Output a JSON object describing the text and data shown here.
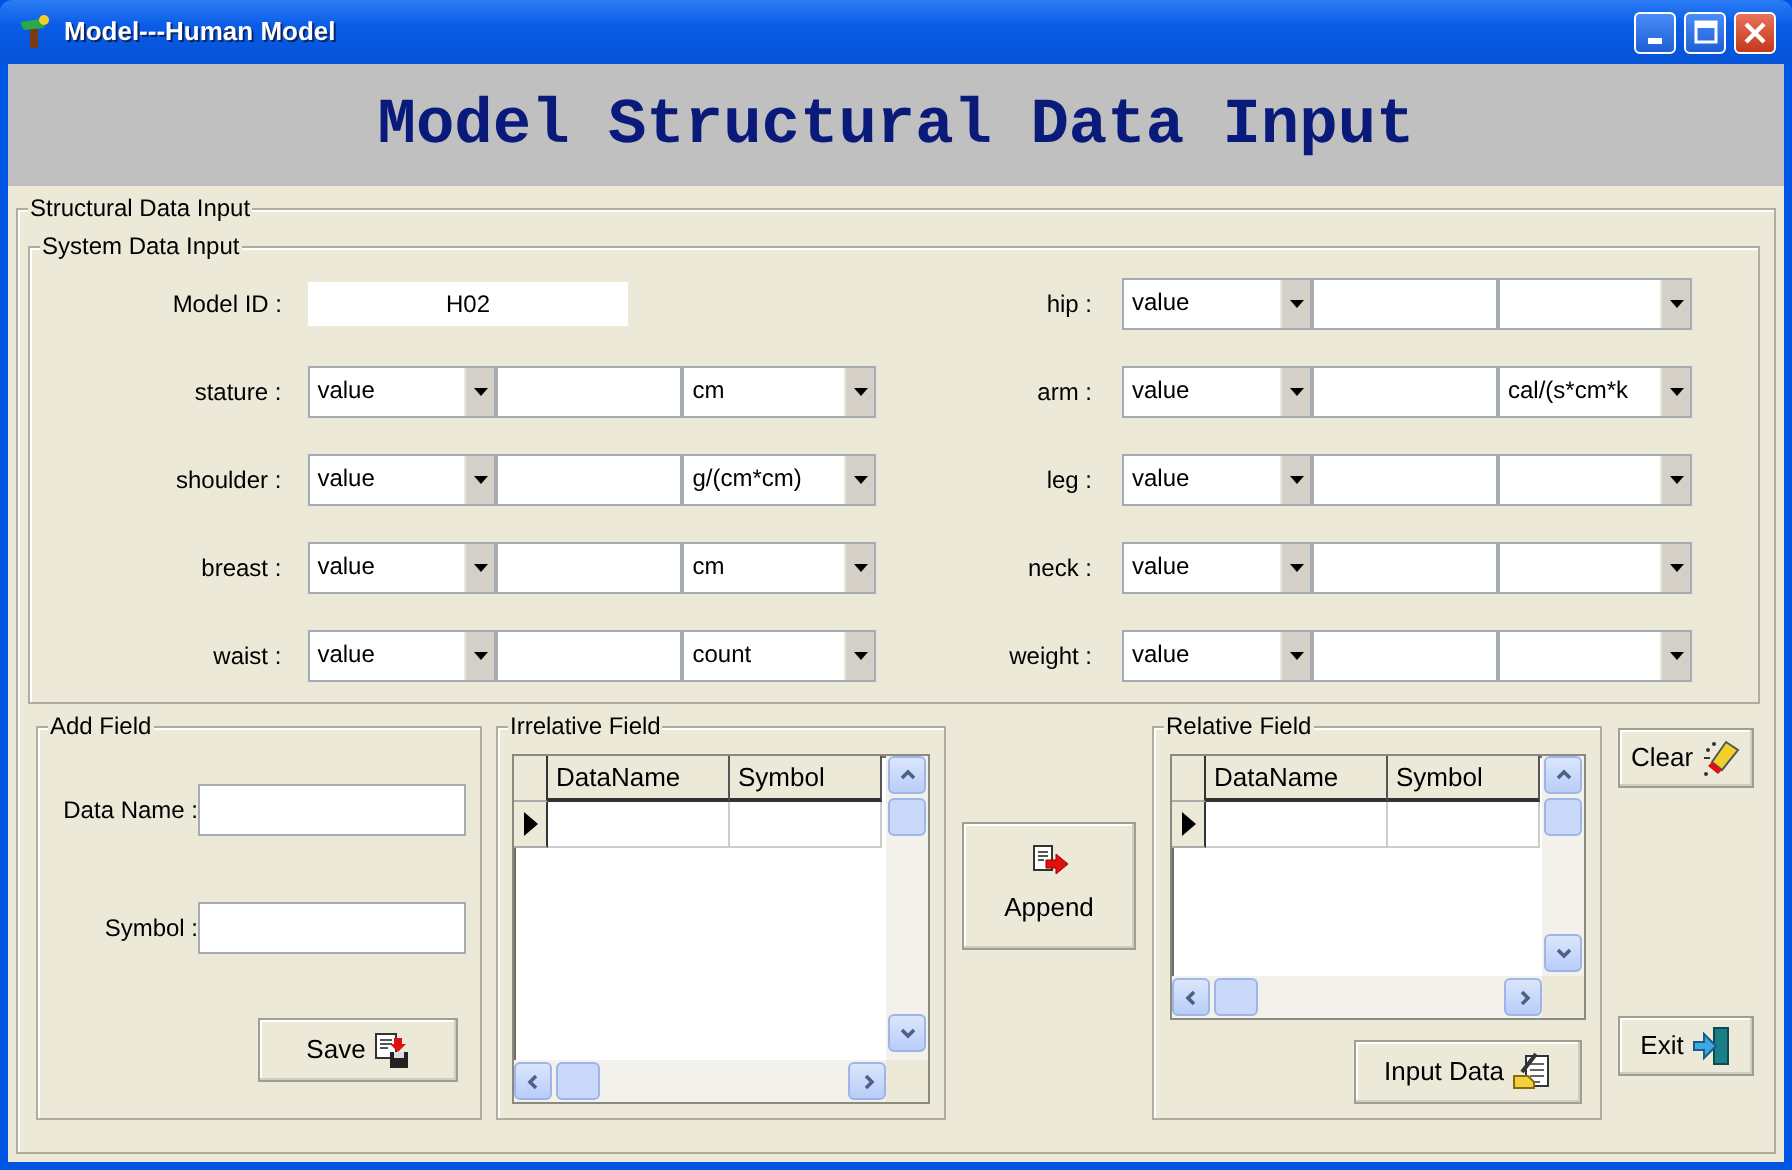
{
  "window": {
    "title": "Model---Human Model"
  },
  "header": {
    "title": "Model Structural Data Input"
  },
  "structural_group": {
    "title": "Structural Data Input"
  },
  "system_group": {
    "title": "System Data Input",
    "model_id": {
      "label": "Model ID :",
      "value": "H02"
    },
    "left_rows": [
      {
        "label": "stature :",
        "mode": "value",
        "unit": "cm"
      },
      {
        "label": "shoulder :",
        "mode": "value",
        "unit": "g/(cm*cm)"
      },
      {
        "label": "breast :",
        "mode": "value",
        "unit": "cm"
      },
      {
        "label": "waist :",
        "mode": "value",
        "unit": "count"
      }
    ],
    "right_rows": [
      {
        "label": "hip :",
        "mode": "value"
      },
      {
        "label": "arm :",
        "mode": "value",
        "unit": "cal/(s*cm*k"
      },
      {
        "label": "leg :",
        "mode": "value"
      },
      {
        "label": "neck :",
        "mode": "value"
      },
      {
        "label": "weight :",
        "mode": "value"
      }
    ]
  },
  "add_field": {
    "title": "Add Field",
    "fields": [
      {
        "label": "Data Name :"
      },
      {
        "label": "Symbol :"
      }
    ],
    "save_button": "Save"
  },
  "irrelative_field": {
    "title": "Irrelative Field",
    "columns": [
      "DataName",
      "Symbol"
    ]
  },
  "append_button": "Append",
  "relative_field": {
    "title": "Relative Field",
    "columns": [
      "DataName",
      "Symbol"
    ],
    "input_data_button": "Input Data"
  },
  "clear_button": "Clear",
  "exit_button": "Exit"
}
